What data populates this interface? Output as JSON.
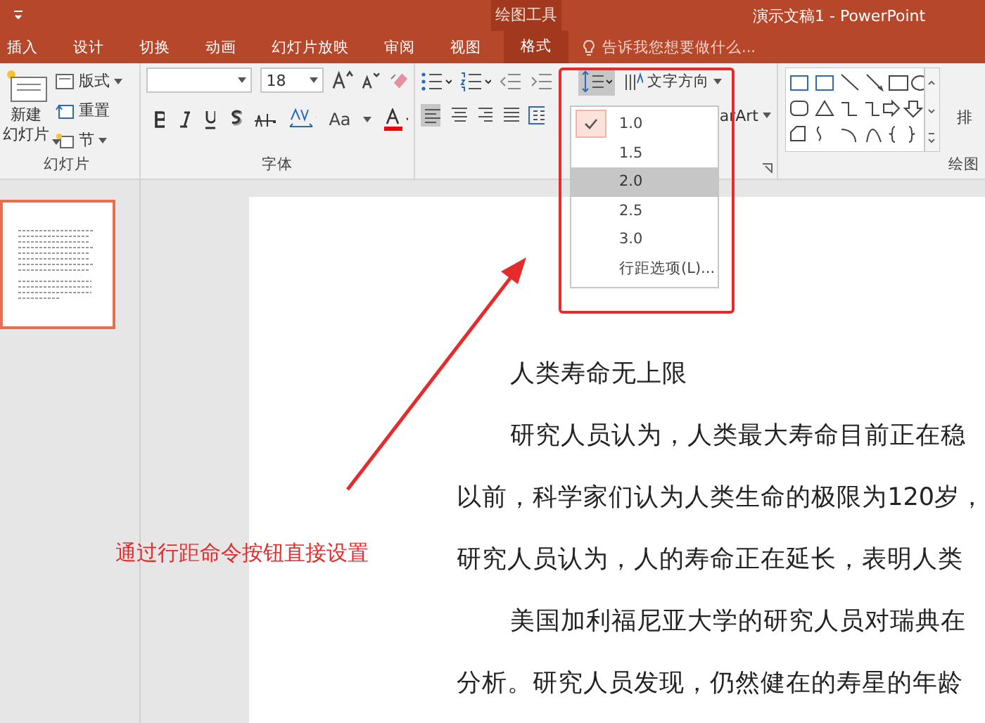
{
  "window": {
    "title": "演示文稿1 - PowerPoint"
  },
  "ribbon_tabs": [
    {
      "label": "插入",
      "kind": "normal"
    },
    {
      "label": "设计",
      "kind": "normal"
    },
    {
      "label": "切换",
      "kind": "normal"
    },
    {
      "label": "动画",
      "kind": "normal"
    },
    {
      "label": "幻灯片放映",
      "kind": "normal"
    },
    {
      "label": "审阅",
      "kind": "normal"
    },
    {
      "label": "视图",
      "kind": "normal"
    },
    {
      "label": "格式",
      "kind": "contextual"
    }
  ],
  "contextual_tab": {
    "group": "绘图工具"
  },
  "tell_me": {
    "placeholder": "告诉我您想要做什么..."
  },
  "slides_group": {
    "new_slide": [
      "新建",
      "幻灯片"
    ],
    "layout": "版式",
    "reset": "重置",
    "section": "节",
    "label": "幻灯片"
  },
  "font_group": {
    "font_size": "18",
    "change_case": "Aa",
    "label": "字体"
  },
  "paragraph_group": {
    "text_direction": "文字方向",
    "smartart": "arArt",
    "line_spacing_pressed": true
  },
  "drawing_group": {
    "arrange": "排",
    "label": "绘图"
  },
  "line_spacing_menu": [
    {
      "label": "1.0",
      "checked": true,
      "selected": false
    },
    {
      "label": "1.5",
      "checked": false,
      "selected": false
    },
    {
      "label": "2.0",
      "checked": false,
      "selected": true
    },
    {
      "label": "2.5",
      "checked": false,
      "selected": false
    },
    {
      "label": "3.0",
      "checked": false,
      "selected": false
    },
    {
      "label": "行距选项(L)...",
      "checked": false,
      "selected": false
    }
  ],
  "slide": {
    "lines": [
      {
        "text": "人类寿命无上限",
        "indent": true
      },
      {
        "text": "研究人员认为，人类最大寿命目前正在稳",
        "indent": true
      },
      {
        "text": "以前，科学家们认为人类生命的极限为120岁，",
        "indent": false
      },
      {
        "text": "研究人员认为，人的寿命正在延长，表明人类",
        "indent": false
      },
      {
        "text": "美国加利福尼亚大学的研究人员对瑞典在",
        "indent": true
      },
      {
        "text": "分析。研究人员发现，仍然健在的寿星的年龄",
        "indent": false
      }
    ]
  },
  "annotation": {
    "text": "通过行距命令按钮直接设置"
  }
}
